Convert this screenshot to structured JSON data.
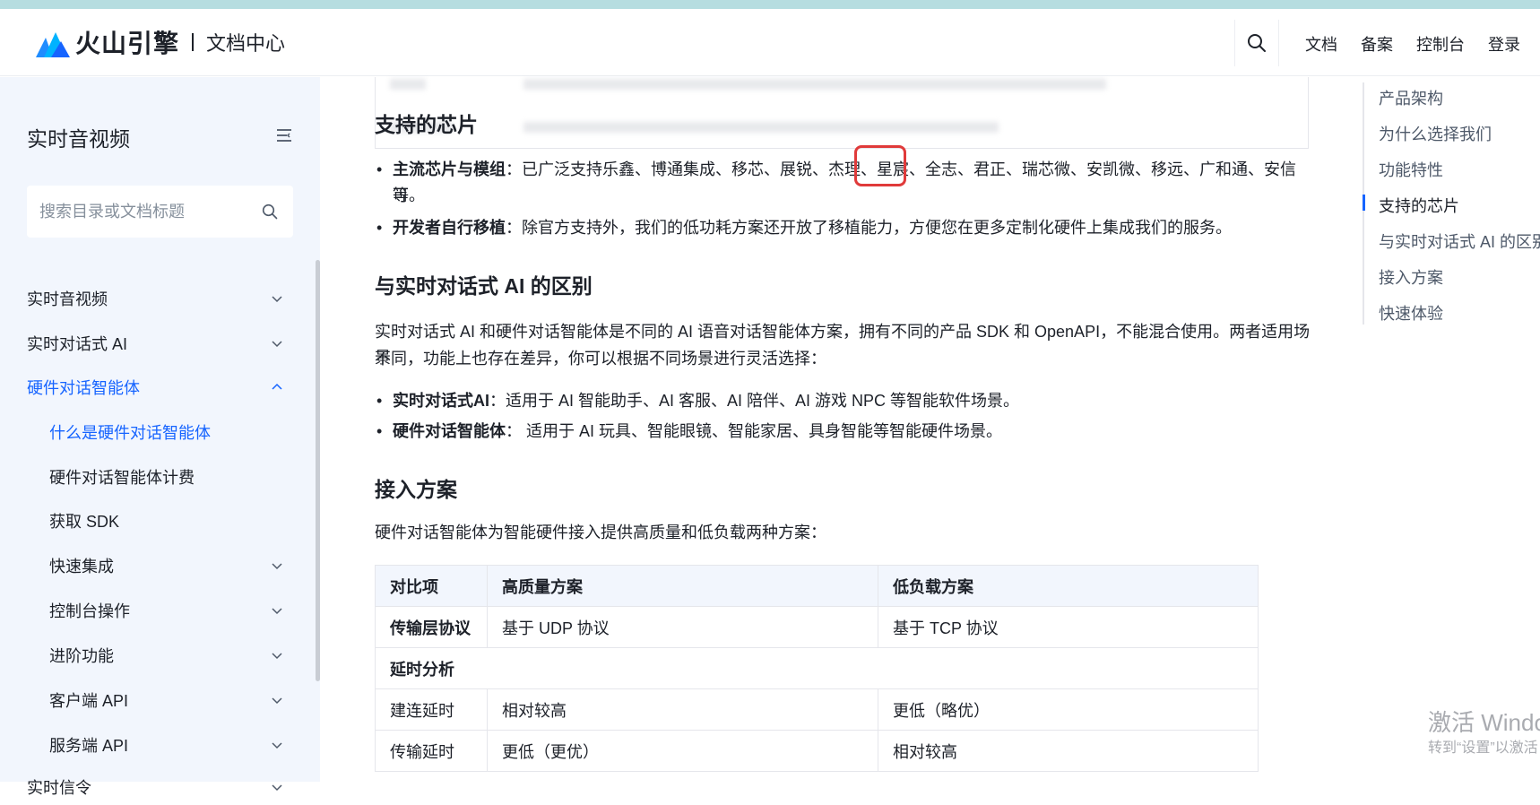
{
  "header": {
    "brand": "火山引擎",
    "section": "文档中心",
    "nav": [
      "文档",
      "备案",
      "控制台",
      "登录"
    ]
  },
  "sidebar": {
    "title": "实时音视频",
    "search_placeholder": "搜索目录或文档标题",
    "items": [
      {
        "label": "实时音视频",
        "expandable": true
      },
      {
        "label": "实时对话式 AI",
        "expandable": true
      },
      {
        "label": "硬件对话智能体",
        "expandable": true,
        "expanded": true
      },
      {
        "label": "什么是硬件对话智能体",
        "child": true,
        "active": true
      },
      {
        "label": "硬件对话智能体计费",
        "child": true
      },
      {
        "label": "获取 SDK",
        "child": true
      },
      {
        "label": "快速集成",
        "child": true,
        "expandable": true
      },
      {
        "label": "控制台操作",
        "child": true,
        "expandable": true
      },
      {
        "label": "进阶功能",
        "child": true,
        "expandable": true
      },
      {
        "label": "客户端 API",
        "child": true,
        "expandable": true
      },
      {
        "label": "服务端 API",
        "child": true,
        "expandable": true
      },
      {
        "label": "实时信令",
        "expandable": true
      }
    ]
  },
  "content": {
    "chips_heading": "支持的芯片",
    "chips_b1_title": "主流芯片与模组",
    "chips_b1_text": "：已广泛支持乐鑫、博通集成、移芯、展锐、杰理、星宸、全志、君正、瑞芯微、安凯微、移远、广和通、安信可",
    "chips_b1_cont": "等。",
    "chips_b2_title": "开发者自行移植",
    "chips_b2_text": "：除官方支持外，我们的低功耗方案还开放了移植能力，方便您在更多定制化硬件上集成我们的服务。",
    "diff_heading": "与实时对话式 AI 的区别",
    "diff_para1": "实时对话式 AI 和硬件对话智能体是不同的 AI 语音对话智能体方案，拥有不同的产品 SDK 和 OpenAPI，不能混合使用。两者适用场景",
    "diff_para2": "不同，功能上也存在差异，你可以根据不同场景进行灵活选择：",
    "diff_b1_title": "实时对话式AI",
    "diff_b1_text": "：适用于 AI 智能助手、AI 客服、AI 陪伴、AI 游戏 NPC 等智能软件场景。",
    "diff_b2_title": "硬件对话智能体",
    "diff_b2_text": "： 适用于 AI 玩具、智能眼镜、智能家居、具身智能等智能硬件场景。",
    "access_heading": "接入方案",
    "access_para": "硬件对话智能体为智能硬件接入提供高质量和低负载两种方案：",
    "table": {
      "headers": [
        "对比项",
        "高质量方案",
        "低负载方案"
      ],
      "rows": [
        {
          "c1": "传输层协议",
          "c2": "基于 UDP 协议",
          "c3": "基于 TCP 协议",
          "bold": true
        },
        {
          "c1": "延时分析",
          "c2": "",
          "c3": "",
          "bold": true,
          "section": true
        },
        {
          "c1": "建连延时",
          "c2": "相对较高",
          "c3": "更低（略优）"
        },
        {
          "c1": "传输延时",
          "c2": "更低（更优）",
          "c3": "相对较高"
        }
      ]
    }
  },
  "toc": {
    "items": [
      "产品架构",
      "为什么选择我们",
      "功能特性",
      "支持的芯片",
      "与实时对话式 AI 的区别",
      "接入方案",
      "快速体验"
    ],
    "current_index": 3
  },
  "watermark": {
    "line1": "激活 Windows",
    "line2": "转到“设置”以激活 Windows。"
  },
  "colors": {
    "accent": "#1664ff",
    "sidebar_bg": "#f2f6fd",
    "highlight_box": "#e03a3a",
    "top_strip": "#b6dde0"
  }
}
